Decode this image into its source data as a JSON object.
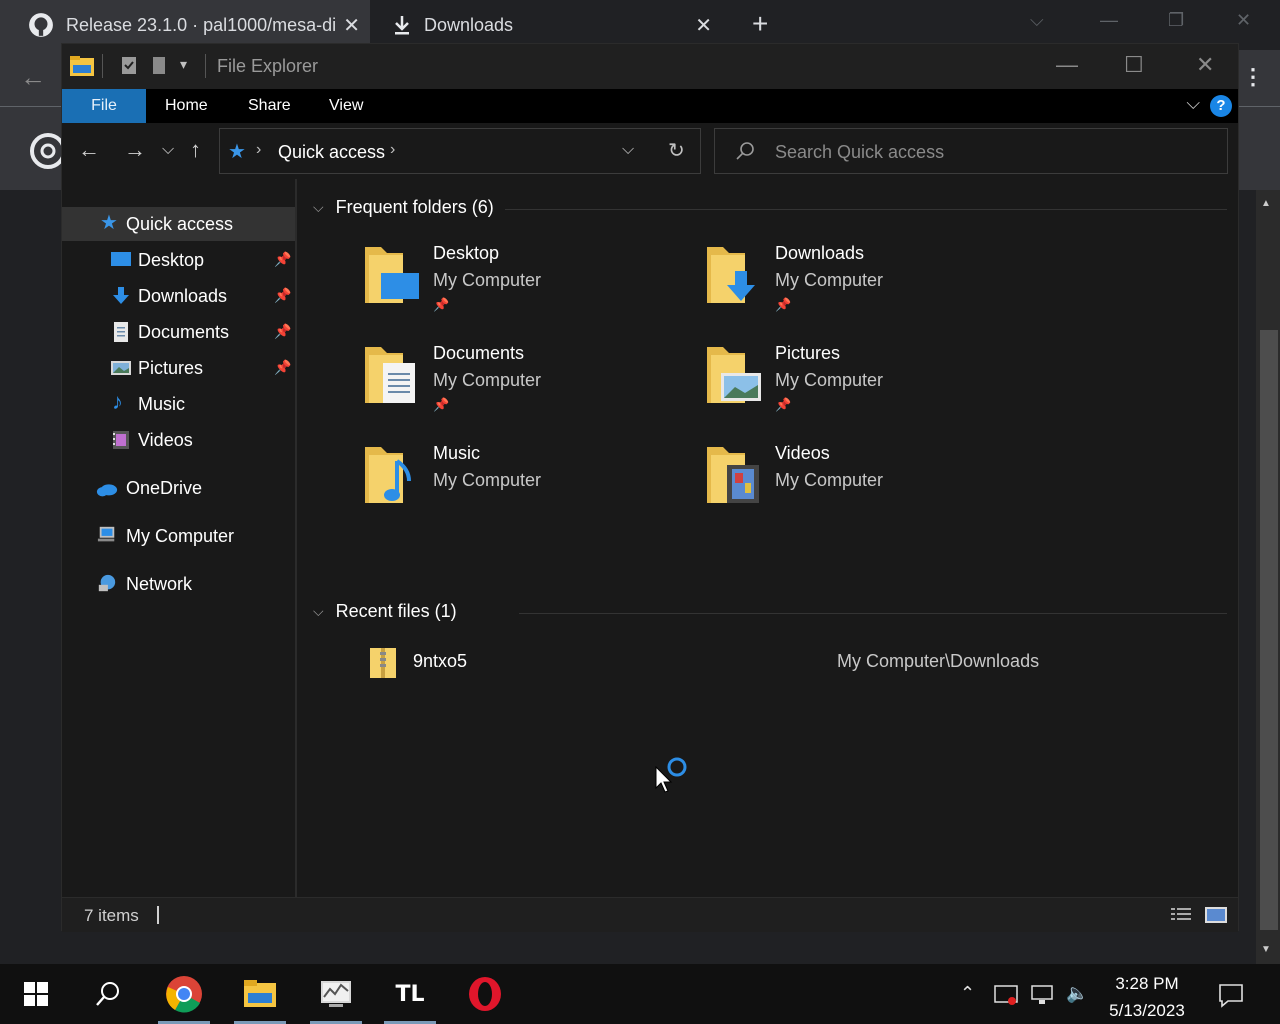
{
  "browser": {
    "tabs": [
      {
        "title": "Release 23.1.0 · pal1000/mesa-di",
        "icon": "github-icon"
      },
      {
        "title": "Downloads",
        "icon": "download-icon"
      }
    ]
  },
  "explorer": {
    "title": "File Explorer",
    "ribbon_tabs": [
      "File",
      "Home",
      "Share",
      "View"
    ],
    "address": {
      "root": "Quick access"
    },
    "search_placeholder": "Search Quick access",
    "nav": {
      "quick_access": "Quick access",
      "pinned": [
        "Desktop",
        "Downloads",
        "Documents",
        "Pictures"
      ],
      "unpinned": [
        "Music",
        "Videos"
      ],
      "onedrive": "OneDrive",
      "my_computer": "My Computer",
      "network": "Network"
    },
    "frequent_header": "Frequent folders (6)",
    "folders": [
      {
        "name": "Desktop",
        "location": "My Computer",
        "pinned": true
      },
      {
        "name": "Downloads",
        "location": "My Computer",
        "pinned": true
      },
      {
        "name": "Documents",
        "location": "My Computer",
        "pinned": true
      },
      {
        "name": "Pictures",
        "location": "My Computer",
        "pinned": true
      },
      {
        "name": "Music",
        "location": "My Computer",
        "pinned": false
      },
      {
        "name": "Videos",
        "location": "My Computer",
        "pinned": false
      }
    ],
    "recent_header": "Recent files (1)",
    "recent_files": [
      {
        "name": "9ntxo5",
        "location": "My Computer\\Downloads"
      }
    ],
    "status": "7 items"
  },
  "taskbar": {
    "time": "3:28 PM",
    "date": "5/13/2023",
    "apps": [
      "windows-start",
      "search",
      "chrome",
      "file-explorer",
      "performance-monitor",
      "tl-app",
      "opera"
    ]
  },
  "colors": {
    "accent": "#1a6fb4",
    "folder": "#f5d26b",
    "background": "#191919"
  }
}
